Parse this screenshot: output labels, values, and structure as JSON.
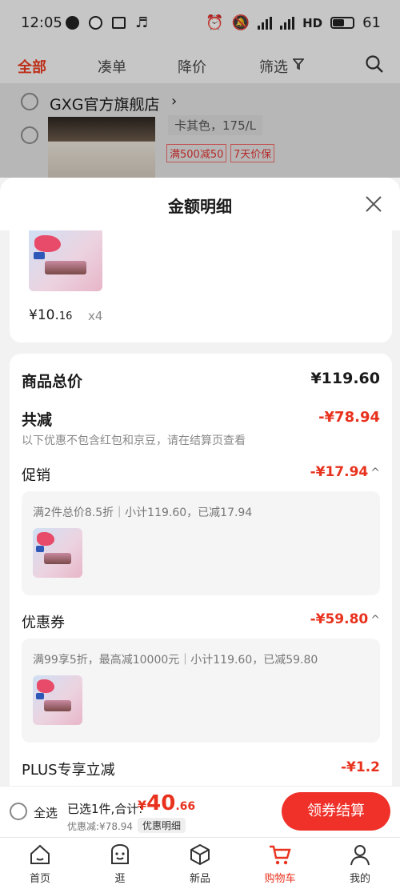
{
  "status_bar": {
    "time": "12:05",
    "network": "HD",
    "battery": "61"
  },
  "top_nav": {
    "tabs": [
      "全部",
      "凑单",
      "降价",
      "筛选"
    ]
  },
  "shop": {
    "name": "GXG官方旗舰店",
    "sku": "卡其色，175/L",
    "promo_tags": [
      "满500减50",
      "7天价保"
    ]
  },
  "sheet": {
    "title": "金额明细",
    "item": {
      "price_main": "¥10.",
      "price_dec": "16",
      "qty": "x4"
    },
    "summary": {
      "total_label": "商品总价",
      "total_value": "¥119.60",
      "discount_label": "共减",
      "discount_value": "-¥78.94",
      "discount_note": "以下优惠不包含红包和京豆，请在结算页查看"
    },
    "promotions": [
      {
        "label": "促销",
        "value": "-¥17.94",
        "detail": "满2件总价8.5折｜小计119.60，已减17.94"
      },
      {
        "label": "优惠券",
        "value": "-¥59.80",
        "detail": "满99享5折，最高减10000元｜小计119.60，已减59.80"
      }
    ],
    "plus": {
      "label": "PLUS专享立减",
      "value": "-¥1.2"
    }
  },
  "bottom_bar": {
    "select_all": "全选",
    "selected_text": "已选1件,合计:",
    "total_symbol": "¥",
    "total_int": "40",
    "total_dec": ".66",
    "discount_text": "优惠减:¥78.94",
    "detail_btn": "优惠明细",
    "checkout_btn": "领券结算"
  },
  "tab_bar": {
    "tabs": [
      "首页",
      "逛",
      "新品",
      "购物车",
      "我的"
    ],
    "active": "购物车"
  },
  "colors": {
    "accent": "#e8321e",
    "checkout": "#f0312a"
  }
}
